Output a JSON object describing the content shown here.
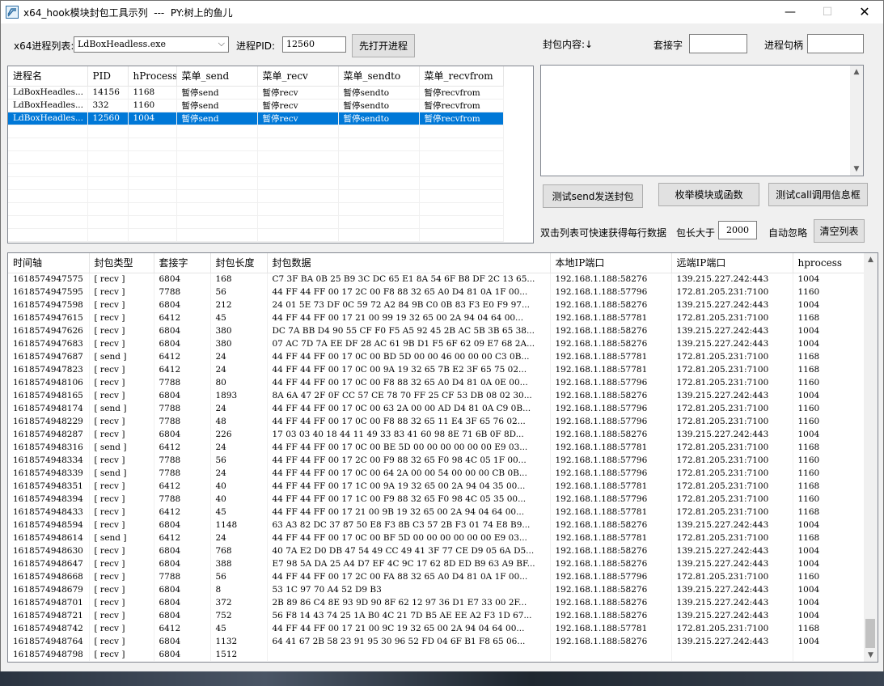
{
  "title": "x64_hook模块封包工具示列  ---  PY:树上的鱼儿",
  "window_controls": {
    "minimize": "—",
    "maximize": "☐",
    "close": "✕"
  },
  "process_combo": {
    "label": "x64进程列表:",
    "value": "LdBoxHeadless.exe"
  },
  "pid": {
    "label": "进程PID:",
    "value": "12560"
  },
  "open_button": "先打开进程",
  "packet_content_label": "封包内容:↓",
  "socket_label": "套接字",
  "socket_value": "",
  "handle_label": "进程句柄",
  "handle_value": "",
  "process_table": {
    "headers": [
      "进程名",
      "PID",
      "hProcess",
      "菜单_send",
      "菜单_recv",
      "菜单_sendto",
      "菜单_recvfrom"
    ],
    "rows": [
      [
        "LdBoxHeadles...",
        "14156",
        "1168",
        "暂停send",
        "暂停recv",
        "暂停sendto",
        "暂停recvfrom"
      ],
      [
        "LdBoxHeadles...",
        "332",
        "1160",
        "暂停send",
        "暂停recv",
        "暂停sendto",
        "暂停recvfrom"
      ],
      [
        "LdBoxHeadles...",
        "12560",
        "1004",
        "暂停send",
        "暂停recv",
        "暂停sendto",
        "暂停recvfrom"
      ]
    ],
    "selected_row": 2
  },
  "buttons": {
    "test_send": "测试send发送封包",
    "enum_module": "枚举模块或函数",
    "test_call": "测试call调用信息框",
    "clear_list": "清空列表"
  },
  "hint_text": "双击列表可快速获得每行数据",
  "size_filter": {
    "label": "包长大于",
    "value": "2000"
  },
  "auto_ignore_label": "自动忽略",
  "packet_table": {
    "headers": [
      "时间轴",
      "封包类型",
      "套接字",
      "封包长度",
      "封包数据",
      "本地IP端口",
      "远端IP端口",
      "hprocess"
    ],
    "rows": [
      [
        "1618574947575",
        "[ recv ]",
        "6804",
        "168",
        "C7 3F BA 0B 25 B9 3C DC 65 E1 8A 54 6F B8 DF 2C 13 65...",
        "192.168.1.188:58276",
        "139.215.227.242:443",
        "1004"
      ],
      [
        "1618574947595",
        "[ recv ]",
        "7788",
        "56",
        "44 FF 44 FF 00 17 2C 00 F8 88 32 65 A0 D4 81 0A 1F 00...",
        "192.168.1.188:57796",
        "172.81.205.231:7100",
        "1160"
      ],
      [
        "1618574947598",
        "[ recv ]",
        "6804",
        "212",
        "24 01 5E 73 DF 0C 59 72 A2 84 9B C0 0B 83 F3 E0 F9 97...",
        "192.168.1.188:58276",
        "139.215.227.242:443",
        "1004"
      ],
      [
        "1618574947615",
        "[ recv ]",
        "6412",
        "45",
        "44 FF 44 FF 00 17 21 00 99 19 32 65 00 2A 94 04 64 00...",
        "192.168.1.188:57781",
        "172.81.205.231:7100",
        "1168"
      ],
      [
        "1618574947626",
        "[ recv ]",
        "6804",
        "380",
        "DC 7A BB D4 90 55 CF F0 F5 A5 92 45 2B AC 5B 3B 65 38...",
        "192.168.1.188:58276",
        "139.215.227.242:443",
        "1004"
      ],
      [
        "1618574947683",
        "[ recv ]",
        "6804",
        "380",
        "07 AC 7D 7A EE DF 28 AC 61 9B D1 F5 6F 62 09 E7 68 2A...",
        "192.168.1.188:58276",
        "139.215.227.242:443",
        "1004"
      ],
      [
        "1618574947687",
        "[ send ]",
        "6412",
        "24",
        "44 FF 44 FF 00 17 0C 00 BD 5D 00 00 46 00 00 00 C3 0B...",
        "192.168.1.188:57781",
        "172.81.205.231:7100",
        "1168"
      ],
      [
        "1618574947823",
        "[ recv ]",
        "6412",
        "24",
        "44 FF 44 FF 00 17 0C 00 9A 19 32 65 7B E2 3F 65 75 02...",
        "192.168.1.188:57781",
        "172.81.205.231:7100",
        "1168"
      ],
      [
        "1618574948106",
        "[ recv ]",
        "7788",
        "80",
        "44 FF 44 FF 00 17 0C 00 F8 88 32 65 A0 D4 81 0A 0E 00...",
        "192.168.1.188:57796",
        "172.81.205.231:7100",
        "1160"
      ],
      [
        "1618574948165",
        "[ recv ]",
        "6804",
        "1893",
        "8A 6A 47 2F 0F CC 57 CE 78 70 FF 25 CF 53 DB 08 02 30...",
        "192.168.1.188:58276",
        "139.215.227.242:443",
        "1004"
      ],
      [
        "1618574948174",
        "[ send ]",
        "7788",
        "24",
        "44 FF 44 FF 00 17 0C 00 63 2A 00 00 AD D4 81 0A C9 0B...",
        "192.168.1.188:57796",
        "172.81.205.231:7100",
        "1160"
      ],
      [
        "1618574948229",
        "[ recv ]",
        "7788",
        "48",
        "44 FF 44 FF 00 17 0C 00 F8 88 32 65 11 E4 3F 65 76 02...",
        "192.168.1.188:57796",
        "172.81.205.231:7100",
        "1160"
      ],
      [
        "1618574948287",
        "[ recv ]",
        "6804",
        "226",
        "17 03 03 40 18 44 11 49 33 83 41 60 98 8E 71 6B 0F 8D...",
        "192.168.1.188:58276",
        "139.215.227.242:443",
        "1004"
      ],
      [
        "1618574948316",
        "[ send ]",
        "6412",
        "24",
        "44 FF 44 FF 00 17 0C 00 BE 5D 00 00 00 00 00 00 E9 03...",
        "192.168.1.188:57781",
        "172.81.205.231:7100",
        "1168"
      ],
      [
        "1618574948334",
        "[ recv ]",
        "7788",
        "56",
        "44 FF 44 FF 00 17 2C 00 F9 88 32 65 F0 98 4C 05 1F 00...",
        "192.168.1.188:57796",
        "172.81.205.231:7100",
        "1160"
      ],
      [
        "1618574948339",
        "[ send ]",
        "7788",
        "24",
        "44 FF 44 FF 00 17 0C 00 64 2A 00 00 54 00 00 00 CB 0B...",
        "192.168.1.188:57796",
        "172.81.205.231:7100",
        "1160"
      ],
      [
        "1618574948351",
        "[ recv ]",
        "6412",
        "40",
        "44 FF 44 FF 00 17 1C 00 9A 19 32 65 00 2A 94 04 35 00...",
        "192.168.1.188:57781",
        "172.81.205.231:7100",
        "1168"
      ],
      [
        "1618574948394",
        "[ recv ]",
        "7788",
        "40",
        "44 FF 44 FF 00 17 1C 00 F9 88 32 65 F0 98 4C 05 35 00...",
        "192.168.1.188:57796",
        "172.81.205.231:7100",
        "1160"
      ],
      [
        "1618574948433",
        "[ recv ]",
        "6412",
        "45",
        "44 FF 44 FF 00 17 21 00 9B 19 32 65 00 2A 94 04 64 00...",
        "192.168.1.188:57781",
        "172.81.205.231:7100",
        "1168"
      ],
      [
        "1618574948594",
        "[ recv ]",
        "6804",
        "1148",
        "63 A3 82 DC 37 87 50 E8 F3 8B C3 57 2B F3 01 74 E8 B9...",
        "192.168.1.188:58276",
        "139.215.227.242:443",
        "1004"
      ],
      [
        "1618574948614",
        "[ send ]",
        "6412",
        "24",
        "44 FF 44 FF 00 17 0C 00 BF 5D 00 00 00 00 00 00 E9 03...",
        "192.168.1.188:57781",
        "172.81.205.231:7100",
        "1168"
      ],
      [
        "1618574948630",
        "[ recv ]",
        "6804",
        "768",
        "40 7A E2 D0 DB 47 54 49 CC 49 41 3F 77 CE D9 05 6A D5...",
        "192.168.1.188:58276",
        "139.215.227.242:443",
        "1004"
      ],
      [
        "1618574948647",
        "[ recv ]",
        "6804",
        "388",
        "E7 98 5A DA 25 A4 D7 EF 4C 9C 17 62 8D ED B9 63 A9 BF...",
        "192.168.1.188:58276",
        "139.215.227.242:443",
        "1004"
      ],
      [
        "1618574948668",
        "[ recv ]",
        "7788",
        "56",
        "44 FF 44 FF 00 17 2C 00 FA 88 32 65 A0 D4 81 0A 1F 00...",
        "192.168.1.188:57796",
        "172.81.205.231:7100",
        "1160"
      ],
      [
        "1618574948679",
        "[ recv ]",
        "6804",
        "8",
        "53 1C 97 70 A4 52 D9 B3",
        "192.168.1.188:58276",
        "139.215.227.242:443",
        "1004"
      ],
      [
        "1618574948701",
        "[ recv ]",
        "6804",
        "372",
        "2B 89 86 C4 8E 93 9D 90 8F 62 12 97 36 D1 E7 33 00 2F...",
        "192.168.1.188:58276",
        "139.215.227.242:443",
        "1004"
      ],
      [
        "1618574948721",
        "[ recv ]",
        "6804",
        "752",
        "56 F8 14 43 74 25 1A B0 4C 21 7D B5 AE EE A2 F3 1D 67...",
        "192.168.1.188:58276",
        "139.215.227.242:443",
        "1004"
      ],
      [
        "1618574948742",
        "[ recv ]",
        "6412",
        "45",
        "44 FF 44 FF 00 17 21 00 9C 19 32 65 00 2A 94 04 64 00...",
        "192.168.1.188:57781",
        "172.81.205.231:7100",
        "1168"
      ],
      [
        "1618574948764",
        "[ recv ]",
        "6804",
        "1132",
        "64 41 67 2B 58 23 91 95 30 96 52 FD 04 6F B1 F8 65 06...",
        "192.168.1.188:58276",
        "139.215.227.242:443",
        "1004"
      ],
      [
        "1618574948798",
        "[ recv ]",
        "6804",
        "1512",
        "",
        "",
        "",
        ""
      ]
    ]
  }
}
